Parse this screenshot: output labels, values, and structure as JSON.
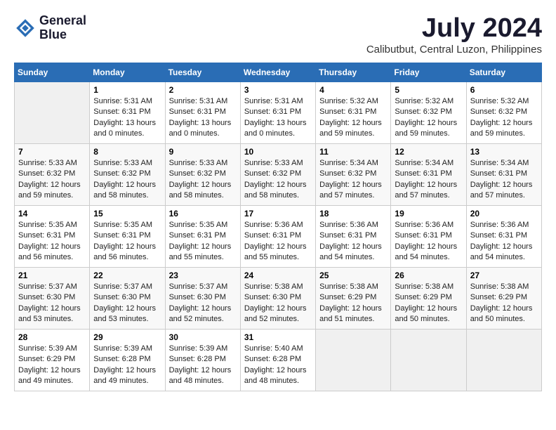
{
  "header": {
    "logo_line1": "General",
    "logo_line2": "Blue",
    "title": "July 2024",
    "subtitle": "Calibutbut, Central Luzon, Philippines"
  },
  "calendar": {
    "days_of_week": [
      "Sunday",
      "Monday",
      "Tuesday",
      "Wednesday",
      "Thursday",
      "Friday",
      "Saturday"
    ],
    "weeks": [
      [
        {
          "day": "",
          "info": ""
        },
        {
          "day": "1",
          "info": "Sunrise: 5:31 AM\nSunset: 6:31 PM\nDaylight: 13 hours\nand 0 minutes."
        },
        {
          "day": "2",
          "info": "Sunrise: 5:31 AM\nSunset: 6:31 PM\nDaylight: 13 hours\nand 0 minutes."
        },
        {
          "day": "3",
          "info": "Sunrise: 5:31 AM\nSunset: 6:31 PM\nDaylight: 13 hours\nand 0 minutes."
        },
        {
          "day": "4",
          "info": "Sunrise: 5:32 AM\nSunset: 6:31 PM\nDaylight: 12 hours\nand 59 minutes."
        },
        {
          "day": "5",
          "info": "Sunrise: 5:32 AM\nSunset: 6:32 PM\nDaylight: 12 hours\nand 59 minutes."
        },
        {
          "day": "6",
          "info": "Sunrise: 5:32 AM\nSunset: 6:32 PM\nDaylight: 12 hours\nand 59 minutes."
        }
      ],
      [
        {
          "day": "7",
          "info": "Sunrise: 5:33 AM\nSunset: 6:32 PM\nDaylight: 12 hours\nand 59 minutes."
        },
        {
          "day": "8",
          "info": "Sunrise: 5:33 AM\nSunset: 6:32 PM\nDaylight: 12 hours\nand 58 minutes."
        },
        {
          "day": "9",
          "info": "Sunrise: 5:33 AM\nSunset: 6:32 PM\nDaylight: 12 hours\nand 58 minutes."
        },
        {
          "day": "10",
          "info": "Sunrise: 5:33 AM\nSunset: 6:32 PM\nDaylight: 12 hours\nand 58 minutes."
        },
        {
          "day": "11",
          "info": "Sunrise: 5:34 AM\nSunset: 6:32 PM\nDaylight: 12 hours\nand 57 minutes."
        },
        {
          "day": "12",
          "info": "Sunrise: 5:34 AM\nSunset: 6:31 PM\nDaylight: 12 hours\nand 57 minutes."
        },
        {
          "day": "13",
          "info": "Sunrise: 5:34 AM\nSunset: 6:31 PM\nDaylight: 12 hours\nand 57 minutes."
        }
      ],
      [
        {
          "day": "14",
          "info": "Sunrise: 5:35 AM\nSunset: 6:31 PM\nDaylight: 12 hours\nand 56 minutes."
        },
        {
          "day": "15",
          "info": "Sunrise: 5:35 AM\nSunset: 6:31 PM\nDaylight: 12 hours\nand 56 minutes."
        },
        {
          "day": "16",
          "info": "Sunrise: 5:35 AM\nSunset: 6:31 PM\nDaylight: 12 hours\nand 55 minutes."
        },
        {
          "day": "17",
          "info": "Sunrise: 5:36 AM\nSunset: 6:31 PM\nDaylight: 12 hours\nand 55 minutes."
        },
        {
          "day": "18",
          "info": "Sunrise: 5:36 AM\nSunset: 6:31 PM\nDaylight: 12 hours\nand 54 minutes."
        },
        {
          "day": "19",
          "info": "Sunrise: 5:36 AM\nSunset: 6:31 PM\nDaylight: 12 hours\nand 54 minutes."
        },
        {
          "day": "20",
          "info": "Sunrise: 5:36 AM\nSunset: 6:31 PM\nDaylight: 12 hours\nand 54 minutes."
        }
      ],
      [
        {
          "day": "21",
          "info": "Sunrise: 5:37 AM\nSunset: 6:30 PM\nDaylight: 12 hours\nand 53 minutes."
        },
        {
          "day": "22",
          "info": "Sunrise: 5:37 AM\nSunset: 6:30 PM\nDaylight: 12 hours\nand 53 minutes."
        },
        {
          "day": "23",
          "info": "Sunrise: 5:37 AM\nSunset: 6:30 PM\nDaylight: 12 hours\nand 52 minutes."
        },
        {
          "day": "24",
          "info": "Sunrise: 5:38 AM\nSunset: 6:30 PM\nDaylight: 12 hours\nand 52 minutes."
        },
        {
          "day": "25",
          "info": "Sunrise: 5:38 AM\nSunset: 6:29 PM\nDaylight: 12 hours\nand 51 minutes."
        },
        {
          "day": "26",
          "info": "Sunrise: 5:38 AM\nSunset: 6:29 PM\nDaylight: 12 hours\nand 50 minutes."
        },
        {
          "day": "27",
          "info": "Sunrise: 5:38 AM\nSunset: 6:29 PM\nDaylight: 12 hours\nand 50 minutes."
        }
      ],
      [
        {
          "day": "28",
          "info": "Sunrise: 5:39 AM\nSunset: 6:29 PM\nDaylight: 12 hours\nand 49 minutes."
        },
        {
          "day": "29",
          "info": "Sunrise: 5:39 AM\nSunset: 6:28 PM\nDaylight: 12 hours\nand 49 minutes."
        },
        {
          "day": "30",
          "info": "Sunrise: 5:39 AM\nSunset: 6:28 PM\nDaylight: 12 hours\nand 48 minutes."
        },
        {
          "day": "31",
          "info": "Sunrise: 5:40 AM\nSunset: 6:28 PM\nDaylight: 12 hours\nand 48 minutes."
        },
        {
          "day": "",
          "info": ""
        },
        {
          "day": "",
          "info": ""
        },
        {
          "day": "",
          "info": ""
        }
      ]
    ]
  }
}
